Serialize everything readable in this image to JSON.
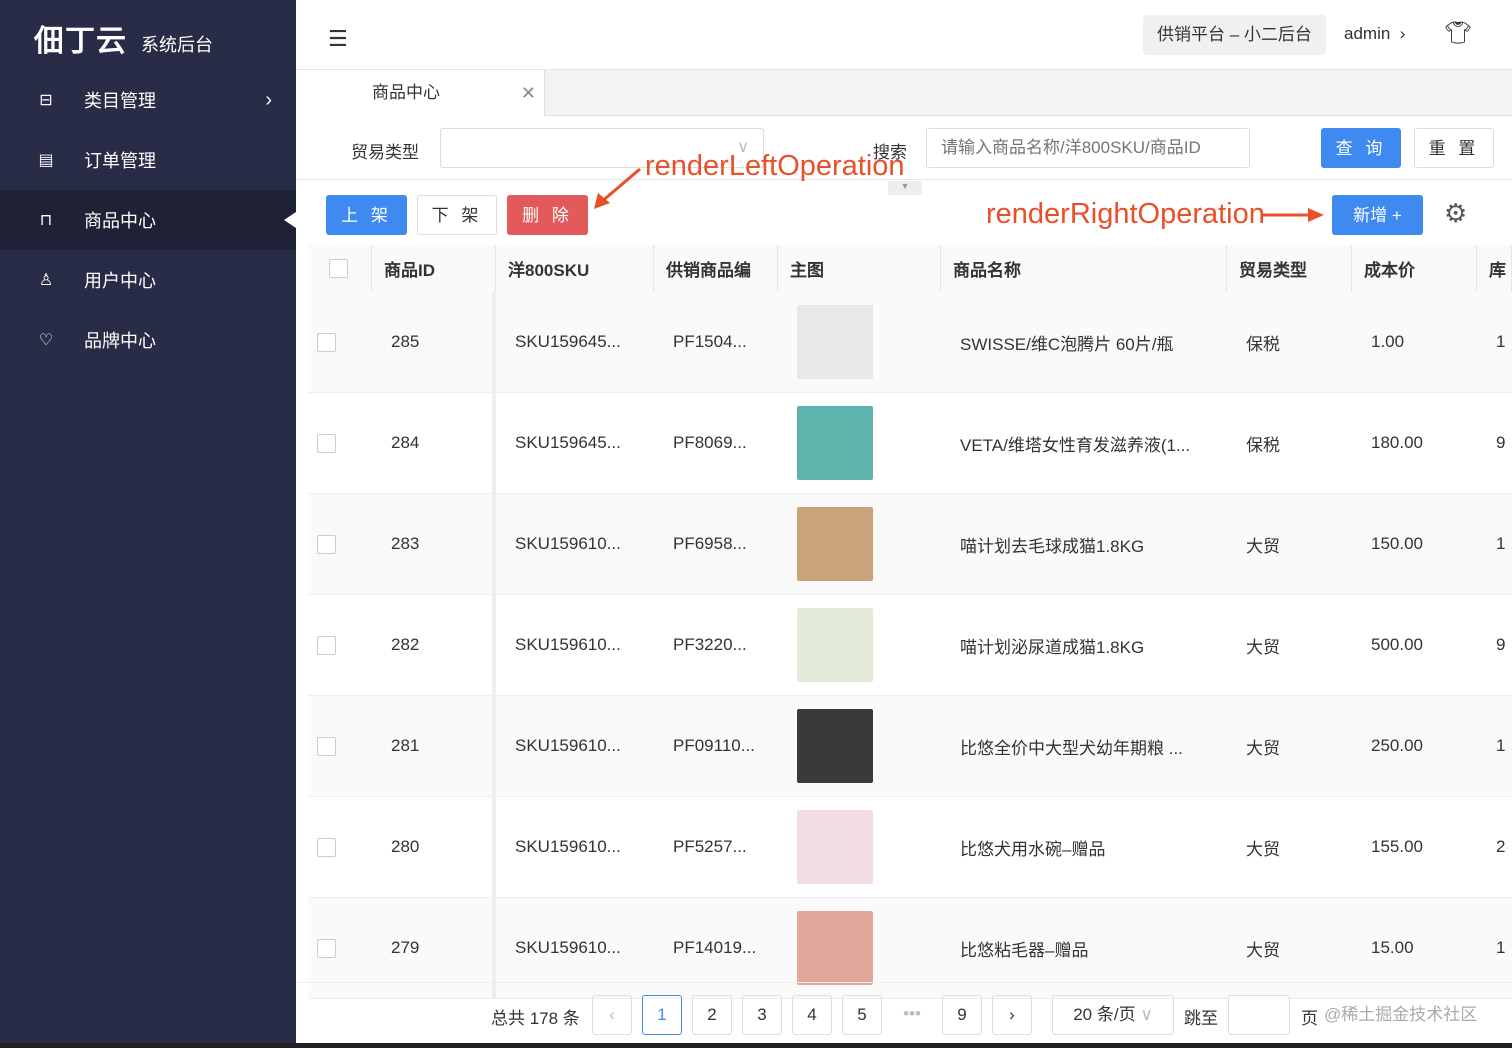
{
  "sidebar": {
    "logo": "佃丁云",
    "subtitle": "系统后台",
    "items": [
      {
        "label": "类目管理",
        "icon": "briefcase-icon"
      },
      {
        "label": "订单管理",
        "icon": "clipboard-icon"
      },
      {
        "label": "商品中心",
        "icon": "bag-icon"
      },
      {
        "label": "用户中心",
        "icon": "user-icon"
      },
      {
        "label": "品牌中心",
        "icon": "heart-hand-icon"
      }
    ]
  },
  "header": {
    "platform": "供销平台 – 小二后台",
    "user": "admin"
  },
  "tabs": [
    {
      "label": "商品中心"
    }
  ],
  "filter": {
    "trade_label": "贸易类型",
    "trade_value": "",
    "search_label": "搜索",
    "search_placeholder": "请输入商品名称/洋800SKU/商品ID",
    "query": "查 询",
    "reset": "重 置"
  },
  "ops": {
    "up": "上 架",
    "down": "下 架",
    "delete": "删 除",
    "add": "新增 +",
    "left_annotation": "renderLeftOperation",
    "right_annotation": "renderRightOperation"
  },
  "table": {
    "columns": [
      "商品ID",
      "洋800SKU",
      "供销商品编",
      "主图",
      "商品名称",
      "贸易类型",
      "成本价",
      "库"
    ],
    "rows": [
      {
        "id": "285",
        "sku": "SKU159645...",
        "pf": "PF1504...",
        "name": "SWISSE/维C泡腾片 60片/瓶",
        "trade": "保税",
        "cost": "1.00",
        "stock": "1",
        "img": "#e8e8e8"
      },
      {
        "id": "284",
        "sku": "SKU159645...",
        "pf": "PF8069...",
        "name": "VETA/维塔女性育发滋养液(1...",
        "trade": "保税",
        "cost": "180.00",
        "stock": "9",
        "img": "#5fb3ad"
      },
      {
        "id": "283",
        "sku": "SKU159610...",
        "pf": "PF6958...",
        "name": "喵计划去毛球成猫1.8KG",
        "trade": "大贸",
        "cost": "150.00",
        "stock": "1",
        "img": "#c9a47a"
      },
      {
        "id": "282",
        "sku": "SKU159610...",
        "pf": "PF3220...",
        "name": "喵计划泌尿道成猫1.8KG",
        "trade": "大贸",
        "cost": "500.00",
        "stock": "9",
        "img": "#e4ead8"
      },
      {
        "id": "281",
        "sku": "SKU159610...",
        "pf": "PF09110...",
        "name": "比悠全价中大型犬幼年期粮 ...",
        "trade": "大贸",
        "cost": "250.00",
        "stock": "1",
        "img": "#3a3a3a"
      },
      {
        "id": "280",
        "sku": "SKU159610...",
        "pf": "PF5257...",
        "name": "比悠犬用水碗–赠品",
        "trade": "大贸",
        "cost": "155.00",
        "stock": "2",
        "img": "#f3dde4"
      },
      {
        "id": "279",
        "sku": "SKU159610...",
        "pf": "PF14019...",
        "name": "比悠粘毛器–赠品",
        "trade": "大贸",
        "cost": "15.00",
        "stock": "1",
        "img": "#e0a89a"
      }
    ]
  },
  "pagination": {
    "total": "总共 178 条",
    "pages": [
      "1",
      "2",
      "3",
      "4",
      "5",
      "9"
    ],
    "ellipsis": "•••",
    "size": "20 条/页",
    "jump": "跳至",
    "page_suffix": "页",
    "watermark": "@稀土掘金技术社区"
  }
}
